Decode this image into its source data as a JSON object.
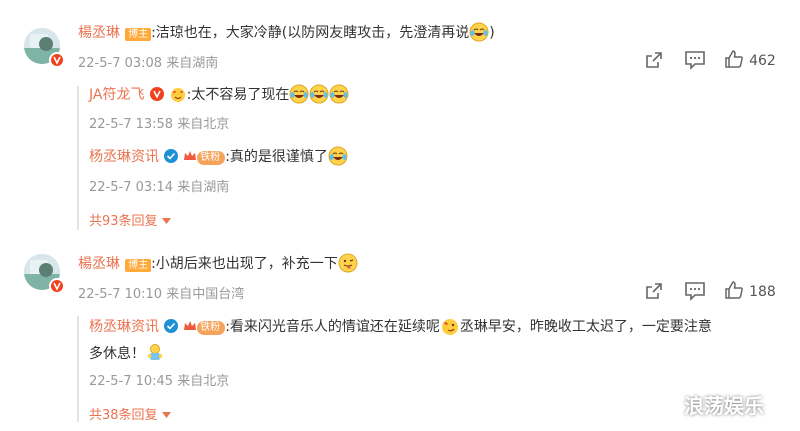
{
  "comments": [
    {
      "user": "楊丞琳",
      "badge": "博主",
      "text_parts": [
        ":洁琼也在，大家冷静(以防网友瞎攻击，先澄清再说",
        ")"
      ],
      "time": "22-5-7 03:08",
      "location": "来自湖南",
      "likes": "462",
      "replies": [
        {
          "user": "JA符龙飞",
          "text": ":太不容易了现在",
          "time": "22-5-7 13:58",
          "location": "来自北京"
        },
        {
          "user": "杨丞琳资讯",
          "fan_label": "铁粉",
          "text": ":真的是很谨慎了",
          "time": "22-5-7 03:14",
          "location": "来自湖南"
        }
      ],
      "more_replies": "共93条回复"
    },
    {
      "user": "楊丞琳",
      "badge": "博主",
      "text": ":小胡后来也出现了，补充一下",
      "time": "22-5-7 10:10",
      "location": "来自中国台湾",
      "likes": "188",
      "replies": [
        {
          "user": "杨丞琳资讯",
          "fan_label": "铁粉",
          "text_line1_a": ":看来闪光音乐人的情谊还在延续呢",
          "text_line1_b": "丞琳早安，昨晚收工太迟了，一定要注意",
          "text_line2": "多休息！",
          "time": "22-5-7 10:45",
          "location": "来自北京"
        }
      ],
      "more_replies": "共38条回复"
    }
  ],
  "watermark": "浪荡娱乐",
  "icons": {
    "share": "share-icon",
    "comment": "comment-icon",
    "like": "thumbs-up-icon",
    "laugh_cry": "laugh-cry-emoji",
    "tongue": "tongue-emoji",
    "rose": "rose-emoji",
    "figure": "figure-emoji"
  },
  "colors": {
    "name": "#eb7350",
    "meta": "#999999",
    "badge": "#ffa938",
    "text": "#333333"
  }
}
